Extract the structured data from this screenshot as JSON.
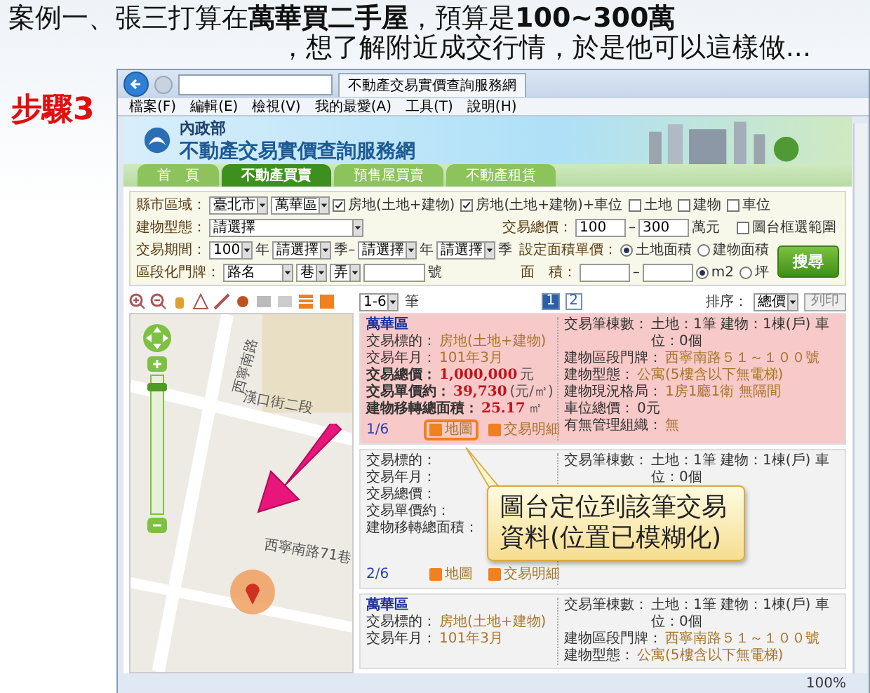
{
  "slide": {
    "title_lines": [
      "案例一、張三打算在**萬華買二手屋**，預算是**100~300萬**",
      "，想了解附近成交行情，於是他可以這樣做..."
    ],
    "step": "步驟3"
  },
  "browser": {
    "tab_title": "不動產交易實價查詢服務網",
    "menu": [
      "檔案(F)",
      "編輯(E)",
      "檢視(V)",
      "我的最愛(A)",
      "工具(T)",
      "說明(H)"
    ],
    "zoom": "100%"
  },
  "site": {
    "ministry": "內政部",
    "name": "不動產交易實價查詢服務網",
    "nav": [
      {
        "label": "首　頁",
        "selected": false
      },
      {
        "label": "不動產買賣",
        "selected": true
      },
      {
        "label": "預售屋買賣",
        "selected": false
      },
      {
        "label": "不動產租賃",
        "selected": false
      }
    ]
  },
  "form": {
    "region_label": "縣市區域：",
    "city": "臺北市",
    "district": "萬華區",
    "types": [
      {
        "label": "房地(土地+建物)",
        "checked": true
      },
      {
        "label": "房地(土地+建物)+車位",
        "checked": true
      },
      {
        "label": "土地",
        "checked": false
      },
      {
        "label": "建物",
        "checked": false
      },
      {
        "label": "車位",
        "checked": false
      }
    ],
    "map_select": {
      "label": "圖台框選範圍",
      "checked": false
    },
    "building_label": "建物型態：",
    "building": "請選擇",
    "price_label": "交易總價：",
    "price_min": "100",
    "range_separator": "–",
    "price_max": "300",
    "price_unit": "萬元",
    "period_label": "交易期間：",
    "year_from": "100",
    "year_unit": "年",
    "season_from": "請選擇",
    "season_unit": "季–",
    "year_to": "請選擇",
    "year_unit2": "年",
    "season_to": "請選擇",
    "season_unit2": "季",
    "unit_price_label": "設定面積單價：",
    "unit_price_options": [
      {
        "label": "土地面積",
        "selected": true
      },
      {
        "label": "建物面積",
        "selected": false
      }
    ],
    "search_button": "搜尋",
    "address_label": "區段化門牌：",
    "road": "路名",
    "lane": "巷",
    "alley": "弄",
    "number_unit": "號",
    "area_label": "面　積：",
    "area_separator": "–",
    "area_units": [
      {
        "label": "m2",
        "selected": true
      },
      {
        "label": "坪",
        "selected": false
      }
    ]
  },
  "map": {
    "streets": [
      "西寧南路",
      "漢口街二段",
      "西寧南路71巷"
    ],
    "zoom": {
      "level": 0.95
    }
  },
  "results": {
    "range": "1-6",
    "range_unit": "筆",
    "pages": [
      {
        "label": "1",
        "selected": true
      },
      {
        "label": "2",
        "selected": false
      }
    ],
    "sort_label": "排序：",
    "sort": "總價",
    "print": "列印",
    "cards": [
      {
        "selected": true,
        "district": "萬華區",
        "index": "1/6",
        "left": [
          {
            "label": "交易標的：",
            "value": "房地(土地+建物)",
            "kind": "plain"
          },
          {
            "label": "交易年月：",
            "value": "101年3月",
            "kind": "plain"
          },
          {
            "label": "交易總價：",
            "value": "1,000,000",
            "unit": "元",
            "kind": "strong"
          },
          {
            "label": "交易單價約：",
            "value": "39,730",
            "unit": "(元/㎡)",
            "kind": "strong"
          },
          {
            "label": "建物移轉總面積：",
            "value": "25.17",
            "unit": "㎡",
            "kind": "strong"
          }
        ],
        "right": [
          {
            "label": "交易筆棟數：",
            "value": "土地：1筆 建物：1棟(戶) 車位：0個",
            "kind": "dark"
          },
          {
            "label": "建物區段門牌：",
            "value": "西寧南路５１～１００號",
            "kind": "plain"
          },
          {
            "label": "建物型態：",
            "value": "公寓(5樓含以下無電梯)",
            "kind": "plain"
          },
          {
            "label": "建物現況格局：",
            "value": "1房1廳1衛 無隔間",
            "kind": "plain"
          },
          {
            "label": "車位總價：",
            "value": "0元",
            "kind": "dark"
          },
          {
            "label": "有無管理組織：",
            "value": "無",
            "kind": "plain"
          }
        ],
        "actions": [
          {
            "label": "地圖",
            "outlined": true
          },
          {
            "label": "交易明細",
            "outlined": false
          }
        ]
      },
      {
        "selected": false,
        "index": "2/6",
        "left": [
          {
            "label": "交易標的：",
            "kind": "plain"
          },
          {
            "label": "交易年月：",
            "kind": "plain"
          },
          {
            "label": "交易總價：",
            "kind": "plain"
          },
          {
            "label": "交易單價約：",
            "kind": "plain"
          },
          {
            "label": "建物移轉總面積：",
            "kind": "plain"
          }
        ],
        "right": [
          {
            "label": "交易筆棟數：",
            "value": "土地：1筆 建物：1棟(戶) 車位：0個",
            "kind": "dark"
          }
        ],
        "actions": [
          {
            "label": "地圖",
            "outlined": false
          },
          {
            "label": "交易明細",
            "outlined": false
          }
        ],
        "callout": "圖台定位到該筆交易資料(位置已模糊化)"
      },
      {
        "selected": false,
        "district": "萬華區",
        "left": [
          {
            "label": "交易標的：",
            "value": "房地(土地+建物)",
            "kind": "plain"
          },
          {
            "label": "交易年月：",
            "value": "101年3月",
            "kind": "plain"
          }
        ],
        "right": [
          {
            "label": "交易筆棟數：",
            "value": "土地：1筆 建物：1棟(戶) 車位：0個",
            "kind": "dark"
          },
          {
            "label": "建物區段門牌：",
            "value": "西寧南路５１～１００號",
            "kind": "plain"
          },
          {
            "label": "建物型態：",
            "value": "公寓(5樓含以下無電梯)",
            "kind": "plain"
          }
        ]
      }
    ]
  }
}
